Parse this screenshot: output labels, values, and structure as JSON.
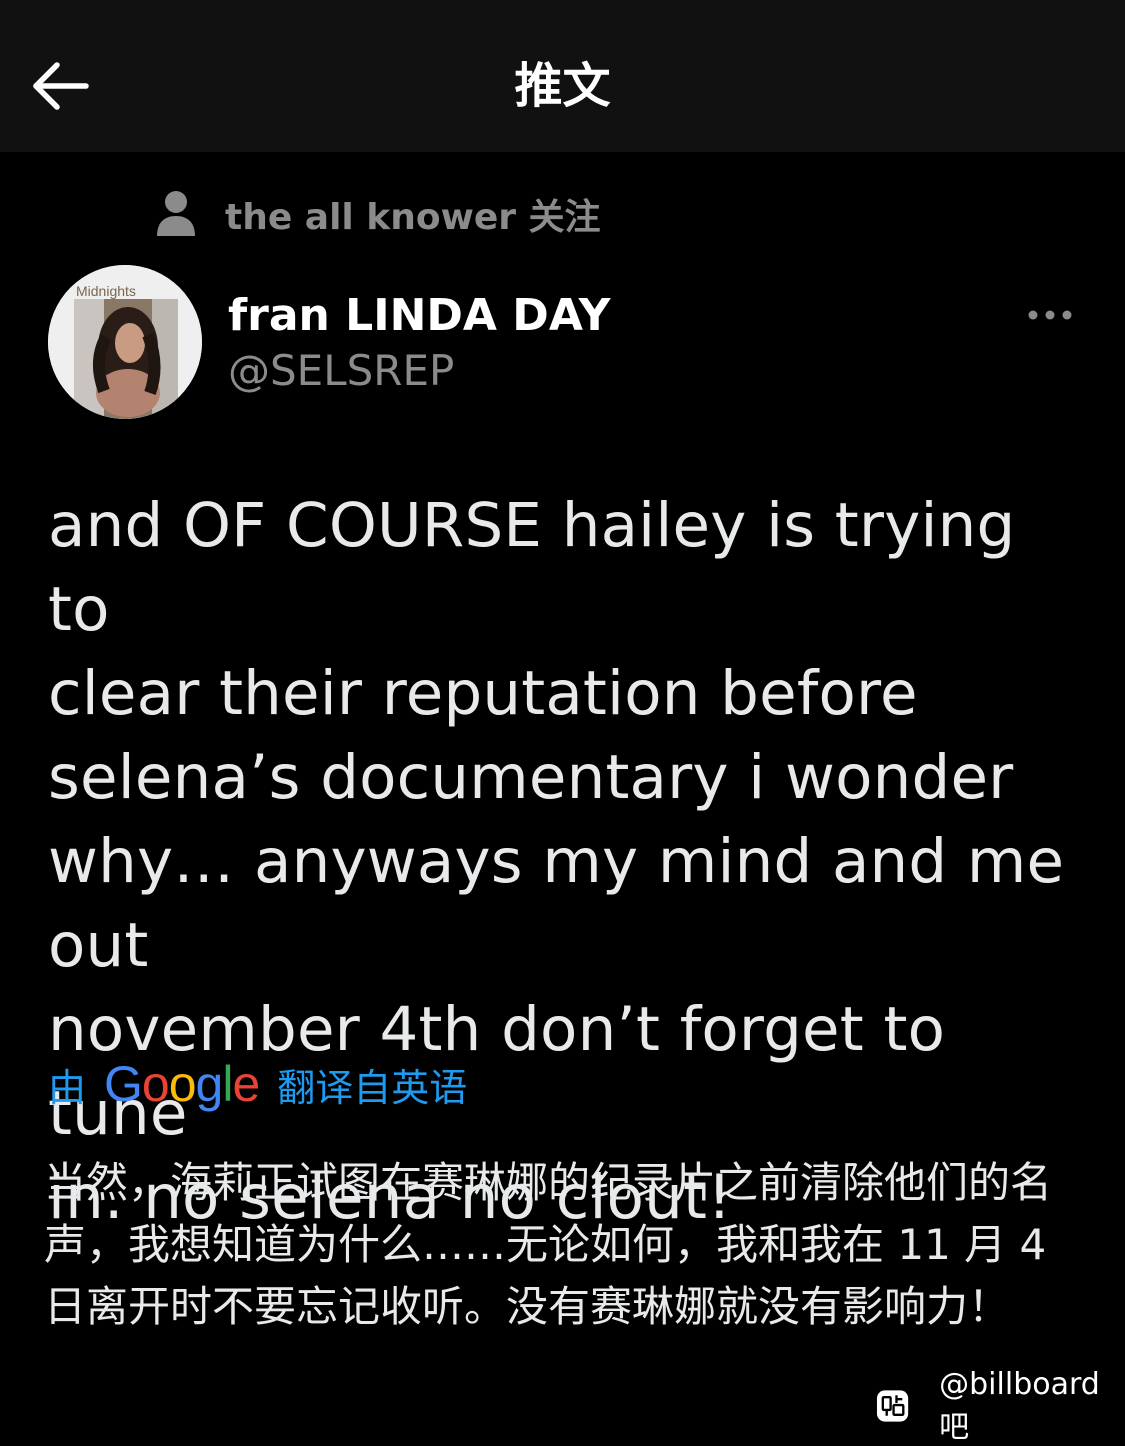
{
  "header": {
    "title": "推文"
  },
  "social_context": {
    "text": "the all knower 关注"
  },
  "author": {
    "avatar_label": "Midnights",
    "display_name": "fran LINDA DAY",
    "handle": "@SELSREP"
  },
  "tweet": {
    "text": "and OF COURSE hailey is trying to\nclear their reputation before\nselena’s documentary i wonder\nwhy… anyways my mind and me out\nnovember 4th don’t forget to tune\nin. no selena no clout!"
  },
  "translation": {
    "prefix": "由",
    "logo": [
      "G",
      "o",
      "o",
      "g",
      "l",
      "e"
    ],
    "logo_colors": [
      "#4285F4",
      "#EA4335",
      "#FBBC05",
      "#4285F4",
      "#34A853",
      "#EA4335"
    ],
    "suffix": "翻译自英语",
    "text": "当然，海莉正试图在赛琳娜的纪录片之前清除他们的名声，我想知道为什么……无论如何，我和我在 11 月 4 日离开时不要忘记收听。没有赛琳娜就没有影响力！"
  },
  "watermark": {
    "icon": "tieba-icon",
    "text": "@billboard吧"
  },
  "colors": {
    "background": "#000000",
    "header_bg": "#111111",
    "link": "#1d9bf0",
    "muted": "#8b8b8b"
  }
}
